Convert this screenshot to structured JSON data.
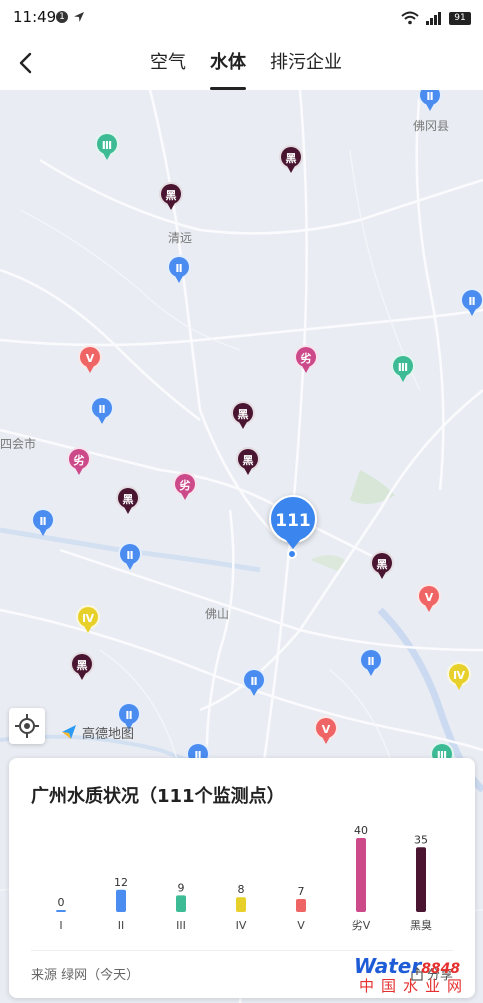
{
  "status_bar": {
    "time": "11:49",
    "notification_count": "1",
    "battery": "91"
  },
  "header": {
    "tabs": [
      {
        "label": "空气",
        "active": false
      },
      {
        "label": "水体",
        "active": true
      },
      {
        "label": "排污企业",
        "active": false
      }
    ]
  },
  "map": {
    "places": [
      "佛冈县",
      "清远",
      "四会市",
      "佛山"
    ],
    "cluster_count": "111",
    "provider_label": "高德地图",
    "pins": [
      {
        "label": "Ⅱ",
        "grade": "II",
        "color": "#4a8cf0"
      },
      {
        "label": "Ⅲ",
        "grade": "III",
        "color": "#3dbb95"
      },
      {
        "label": "黑",
        "grade": "black",
        "color": "#4a1530"
      },
      {
        "label": "黑",
        "grade": "black",
        "color": "#4a1530"
      },
      {
        "label": "Ⅱ",
        "grade": "II",
        "color": "#4a8cf0"
      },
      {
        "label": "Ⅱ",
        "grade": "II",
        "color": "#4a8cf0"
      },
      {
        "label": "Ⅴ",
        "grade": "V",
        "color": "#ef6464"
      },
      {
        "label": "劣",
        "grade": "inferior-V",
        "color": "#cc4a8a"
      },
      {
        "label": "Ⅲ",
        "grade": "III",
        "color": "#3dbb95"
      },
      {
        "label": "Ⅱ",
        "grade": "II",
        "color": "#4a8cf0"
      },
      {
        "label": "黑",
        "grade": "black",
        "color": "#4a1530"
      },
      {
        "label": "劣",
        "grade": "inferior-V",
        "color": "#cc4a8a"
      },
      {
        "label": "黑",
        "grade": "black",
        "color": "#4a1530"
      },
      {
        "label": "劣",
        "grade": "inferior-V",
        "color": "#cc4a8a"
      },
      {
        "label": "黑",
        "grade": "black",
        "color": "#4a1530"
      },
      {
        "label": "Ⅱ",
        "grade": "II",
        "color": "#4a8cf0"
      },
      {
        "label": "Ⅱ",
        "grade": "II",
        "color": "#4a8cf0"
      },
      {
        "label": "黑",
        "grade": "black",
        "color": "#4a1530"
      },
      {
        "label": "Ⅴ",
        "grade": "V",
        "color": "#ef6464"
      },
      {
        "label": "Ⅳ",
        "grade": "IV",
        "color": "#e8d02a"
      },
      {
        "label": "黑",
        "grade": "black",
        "color": "#4a1530"
      },
      {
        "label": "Ⅱ",
        "grade": "II",
        "color": "#4a8cf0"
      },
      {
        "label": "Ⅱ",
        "grade": "II",
        "color": "#4a8cf0"
      },
      {
        "label": "Ⅳ",
        "grade": "IV",
        "color": "#e8d02a"
      },
      {
        "label": "Ⅱ",
        "grade": "II",
        "color": "#4a8cf0"
      },
      {
        "label": "Ⅴ",
        "grade": "V",
        "color": "#ef6464"
      },
      {
        "label": "Ⅱ",
        "grade": "II",
        "color": "#4a8cf0"
      },
      {
        "label": "Ⅲ",
        "grade": "III",
        "color": "#3dbb95"
      }
    ]
  },
  "card": {
    "title": "广州水质状况（111个监测点）",
    "source": "来源 绿网（今天）",
    "share_label": "分享",
    "watermark_top": "Water",
    "watermark_num": "8848",
    "watermark_bottom": "中国水业网"
  },
  "chart_data": {
    "type": "bar",
    "categories": [
      "I",
      "II",
      "III",
      "IV",
      "V",
      "劣V",
      "黑臭"
    ],
    "values": [
      0,
      12,
      9,
      8,
      7,
      40,
      35
    ],
    "colors": [
      "#4a8cf0",
      "#4a8cf0",
      "#3dbb95",
      "#e8d02a",
      "#ef6464",
      "#cc4a8a",
      "#4a1530"
    ],
    "title": "",
    "xlabel": "",
    "ylabel": "",
    "ylim": [
      0,
      40
    ],
    "grid": false,
    "data_labels": true
  }
}
